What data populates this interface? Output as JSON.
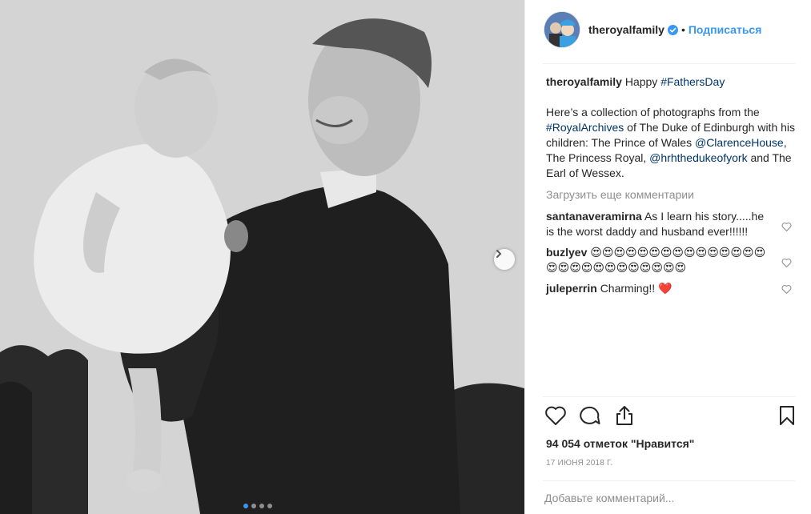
{
  "post": {
    "author": "theroyalfamily",
    "separator": "•",
    "follow_label": "Подписаться",
    "caption": {
      "user": "theroyalfamily",
      "text_before": "Happy ",
      "hashtag1": "#FathersDay",
      "para_1": "Here’s a collection of photographs from the ",
      "hashtag2": "#RoyalArchives",
      "para_2": " of The Duke of Edinburgh with his children: The Prince of Wales ",
      "mention1": "@ClarenceHouse",
      "para_3": ", The Princess Royal, ",
      "mention2": "@hrhthedukeofyork",
      "para_4": " and The Earl of Wessex."
    },
    "load_more": "Загрузить еще комментарии",
    "comments": [
      {
        "user": "santanaveramirna",
        "text": "As I learn his story.....he is the worst daddy and husband ever!!!!!!"
      },
      {
        "user": "buzlyev",
        "text": "😍😍😍😍😍😍😍😍😍😍😍😍😍😍😍😍😍😍😍😍😍😍😍😍😍😍😍"
      },
      {
        "user": "juleperrin",
        "text": "Charming!! ❤️"
      }
    ],
    "likes_text": "94 054 отметок \"Нравится\"",
    "date": "17 ИЮНЯ 2018 Г.",
    "add_comment_placeholder": "Добавьте комментарий...",
    "carousel": {
      "total": 4,
      "active_index": 0
    }
  },
  "icons": {
    "verified": "verified-badge-icon",
    "like": "heart-icon",
    "comment": "comment-icon",
    "share": "share-icon",
    "save": "bookmark-icon",
    "next": "chevron-right-icon"
  },
  "colors": {
    "link": "#003569",
    "accent": "#3897f0",
    "muted": "#8e8e8e",
    "heart_red": "#ed4956"
  }
}
